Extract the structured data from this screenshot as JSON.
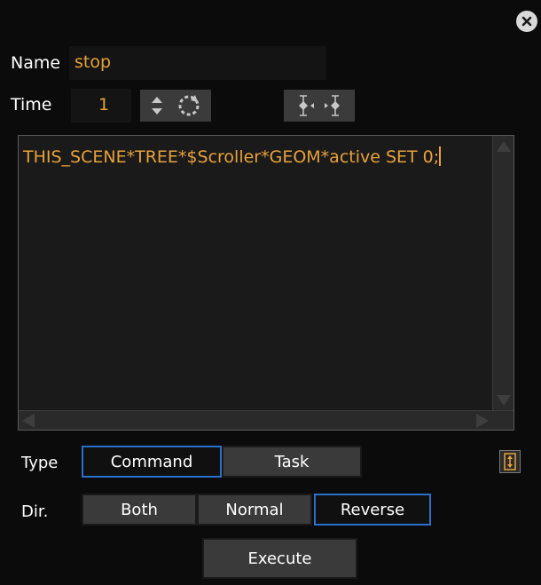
{
  "panel": {
    "name_label": "Name",
    "name_value": "stop",
    "time_label": "Time",
    "time_value": "1",
    "script_text": "THIS_SCENE*TREE*$Scroller*GEOM*active SET 0;"
  },
  "type": {
    "label": "Type",
    "options": [
      "Command",
      "Task"
    ],
    "selected": "Command"
  },
  "direction": {
    "label": "Dir.",
    "options": [
      "Both",
      "Normal",
      "Reverse"
    ],
    "selected": "Reverse"
  },
  "execute_label": "Execute",
  "icons": {
    "close": "close-icon",
    "spinner": "up-down-spinner-icon",
    "reset": "circular-arrow-icon",
    "keyframe": "keyframe-navigation-icon",
    "toggle": "up-down-toggle-icon"
  },
  "colors": {
    "accent_text": "#e8a23a",
    "selected_border": "#2a6fc9",
    "background": "#0b0b0b"
  }
}
